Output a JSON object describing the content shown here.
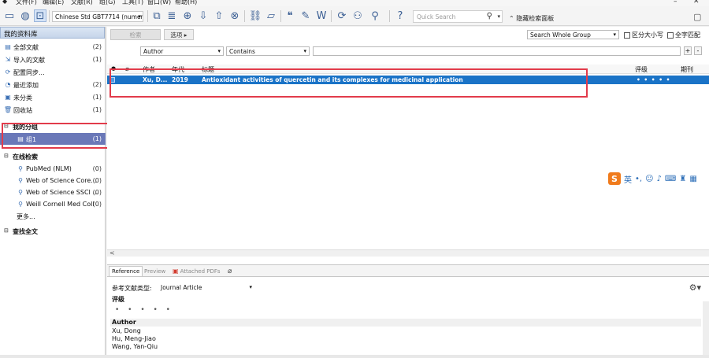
{
  "menu": [
    "文件(F)",
    "编辑(E)",
    "文献(R)",
    "组(G)",
    "工具(T)",
    "窗口(W)",
    "帮助(H)"
  ],
  "toolbar": {
    "style_select": "Chinese Std GBT7714 (numeri",
    "quick_search_placeholder": "Quick Search",
    "hide_panel_label": "隐藏检索面板"
  },
  "sidebar": {
    "header": "我的资料库",
    "items": [
      {
        "label": "全部文献",
        "count": "(2)",
        "icon": "library-icon"
      },
      {
        "label": "导入的文献",
        "count": "(1)",
        "icon": "import-icon"
      },
      {
        "label": "配置同步...",
        "count": "",
        "icon": "sync-icon"
      },
      {
        "label": "最近添加",
        "count": "(2)",
        "icon": "recent-icon"
      },
      {
        "label": "未分类",
        "count": "(1)",
        "icon": "unfiled-icon"
      },
      {
        "label": "回收站",
        "count": "(1)",
        "icon": "trash-icon"
      }
    ],
    "my_groups": {
      "title": "我的分组",
      "items": [
        {
          "label": "组1",
          "count": "(1)",
          "icon": "group-icon"
        }
      ]
    },
    "online_search": {
      "title": "在线检索",
      "items": [
        {
          "label": "PubMed (NLM)",
          "count": "(0)"
        },
        {
          "label": "Web of Science Core...",
          "count": "(0)"
        },
        {
          "label": "Web of Science SSCI ...",
          "count": "(0)"
        },
        {
          "label": "Weill Cornell Med Coll",
          "count": "(0)"
        }
      ],
      "more": "更多..."
    },
    "find_full_text": "查找全文"
  },
  "search_panel": {
    "search_button": "检索",
    "options_button": "选项",
    "scope": "Search Whole Group",
    "match_case": "区分大小写",
    "match_words": "全字匹配",
    "field": "Author",
    "operator": "Contains",
    "value": ""
  },
  "table": {
    "columns": {
      "author": "作者",
      "year": "年代",
      "title": "标题",
      "rating": "评级",
      "journal": "期刊"
    },
    "rows": [
      {
        "author": "Xu, D...",
        "year": "2019",
        "title": "Antioxidant activities of quercetin and its complexes for medicinal application",
        "rating": "• • • • •",
        "journal": ""
      }
    ]
  },
  "bottom_tabs": {
    "reference": "Reference",
    "preview": "Preview",
    "attached_pdfs": "Attached PDFs"
  },
  "reference": {
    "type_label": "参考文献类型:",
    "type_value": "Journal Article",
    "rating_label": "评级",
    "rating_stars": "• • • • •",
    "author_label": "Author",
    "authors": [
      "Xu, Dong",
      "Hu, Meng-Jiao",
      "Wang, Yan-Qiu"
    ]
  },
  "colors": {
    "selection_blue": "#1a73c7",
    "highlight_red": "#e23b4b",
    "group_selected": "#6a78b8"
  }
}
